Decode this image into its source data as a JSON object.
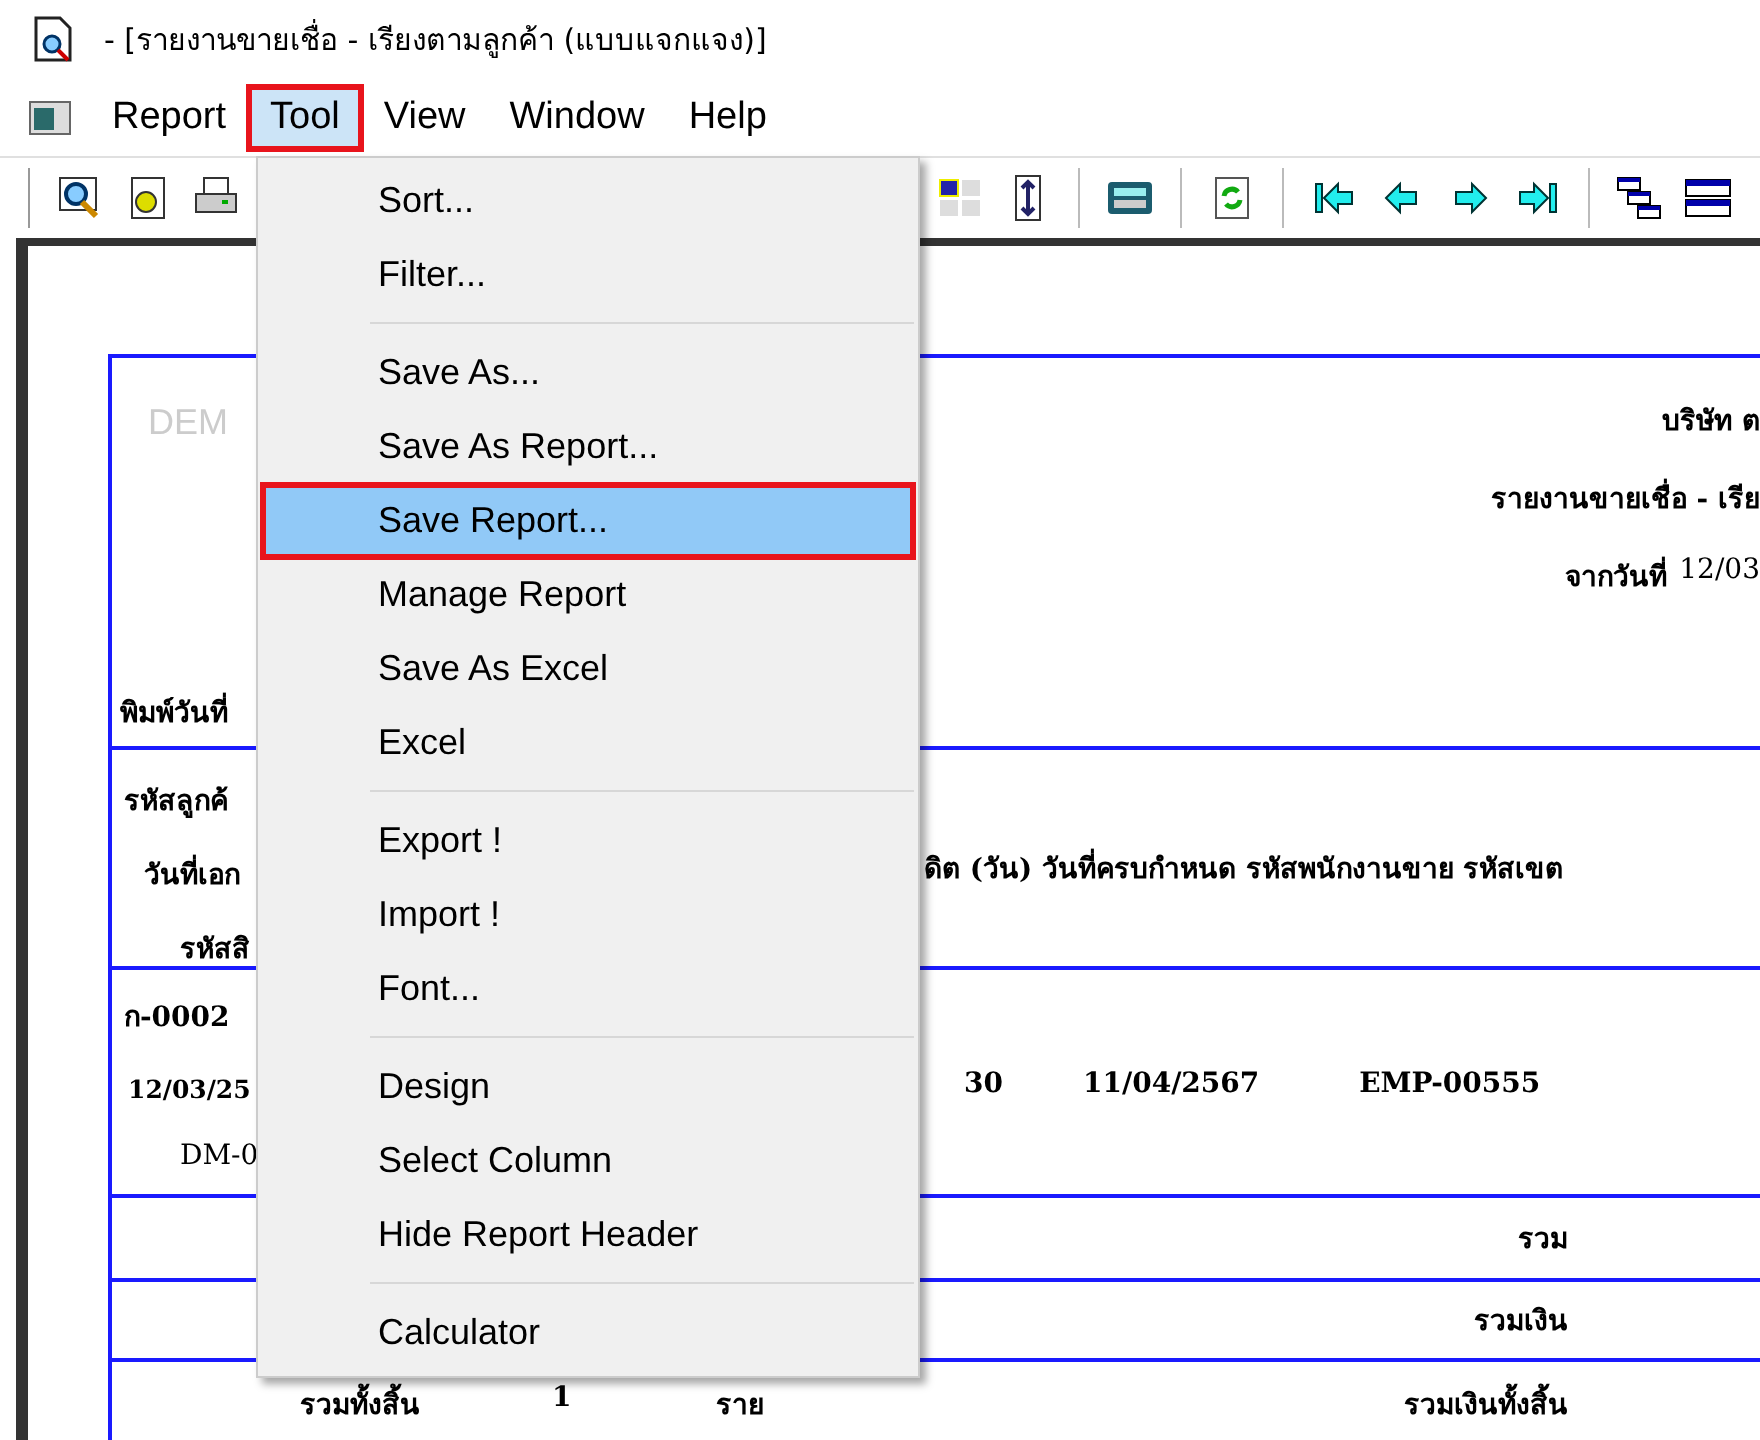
{
  "window": {
    "title": "- [รายงานขายเชื่อ - เรียงตามลูกค้า (แบบแจกแจง)]"
  },
  "menu_bar": [
    {
      "label": "Report",
      "selected": false
    },
    {
      "label": "Tool",
      "selected": true
    },
    {
      "label": "View",
      "selected": false
    },
    {
      "label": "Window",
      "selected": false
    },
    {
      "label": "Help",
      "selected": false
    }
  ],
  "toolbar": {
    "left": [
      {
        "kind": "preview"
      },
      {
        "kind": "settings"
      },
      {
        "kind": "printer"
      }
    ],
    "right": [
      [
        {
          "kind": "grid"
        },
        {
          "kind": "resize"
        }
      ],
      [
        {
          "kind": "calculator"
        }
      ],
      [
        {
          "kind": "refresh"
        }
      ],
      [
        {
          "kind": "first"
        },
        {
          "kind": "prev"
        },
        {
          "kind": "next"
        },
        {
          "kind": "last"
        }
      ],
      [
        {
          "kind": "cascade"
        },
        {
          "kind": "tile"
        }
      ]
    ]
  },
  "dropdown": {
    "groups": [
      [
        {
          "label": "Sort...",
          "selected": false
        },
        {
          "label": "Filter...",
          "selected": false
        }
      ],
      [
        {
          "label": "Save As...",
          "selected": false
        },
        {
          "label": "Save As Report...",
          "selected": false
        },
        {
          "label": "Save Report...",
          "selected": true
        },
        {
          "label": "Manage Report",
          "selected": false
        },
        {
          "label": "Save As Excel",
          "selected": false
        },
        {
          "label": "Excel",
          "selected": false
        }
      ],
      [
        {
          "label": "Export !",
          "selected": false
        },
        {
          "label": "Import !",
          "selected": false
        },
        {
          "label": "Font...",
          "selected": false
        }
      ],
      [
        {
          "label": "Design",
          "selected": false
        },
        {
          "label": "Select Column",
          "selected": false
        },
        {
          "label": "Hide Report Header",
          "selected": false
        }
      ],
      [
        {
          "label": "Calculator",
          "selected": false
        }
      ]
    ]
  },
  "report": {
    "header": {
      "watermark": "DEM",
      "company": "บริษัท ต",
      "title": "รายงานขายเชื่อ - เรีย",
      "date_label": "จากวันที่",
      "date_value": "12/03",
      "printed_label": "พิมพ์วันที่"
    },
    "columns": {
      "line_1_left": "รหัสลูกค้",
      "line_2_left": "วันที่เอก",
      "line_2_right": "ดิต (วัน) วันที่ครบกำหนด รหัสพนักงานขาย  รหัสเขต",
      "line_3_left": "รหัสสิ"
    },
    "record": {
      "customer": "ก-0002",
      "date": "12/03/25",
      "credit_days": "30",
      "due_date": "11/04/2567",
      "salesperson": "EMP-00555",
      "product": "DM-0"
    },
    "totals": [
      {
        "label": "รวม"
      },
      {
        "label": "รวมเงิน"
      }
    ],
    "grand_total": {
      "label": "รวมทั้งสิ้น",
      "count": "1",
      "unit": "ราย",
      "amount_label": "รวมเงินทั้งสิ้น"
    }
  }
}
